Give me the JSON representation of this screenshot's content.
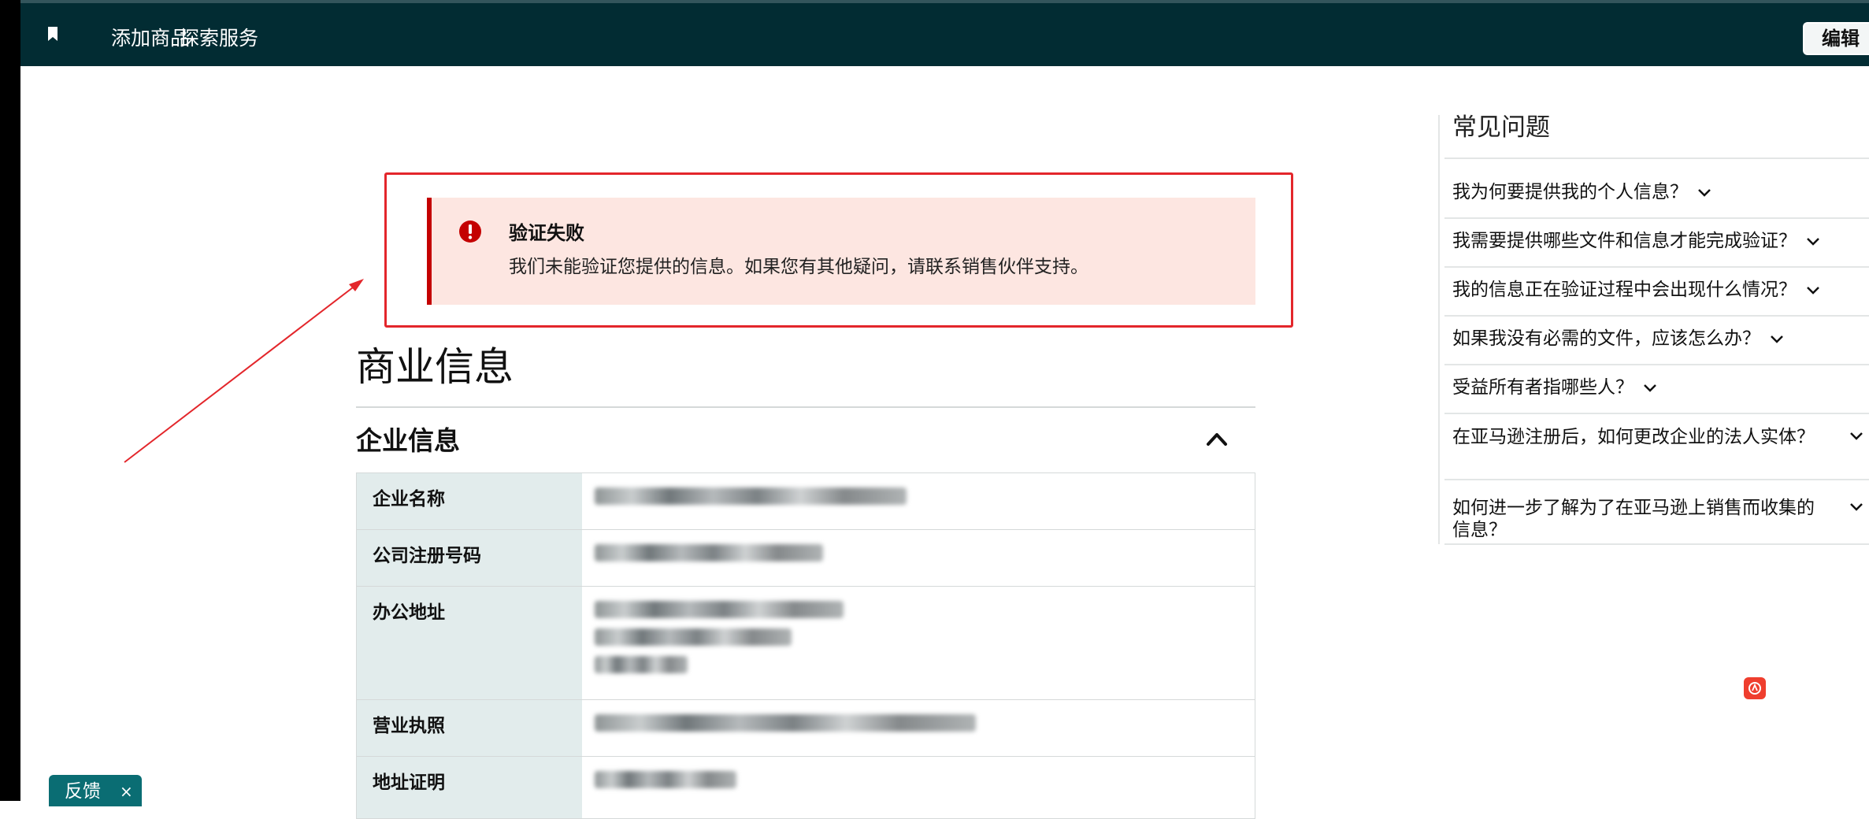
{
  "topbar": {
    "nav_links": [
      "添加商品",
      "探索服务"
    ],
    "edit_label": "编辑"
  },
  "alert": {
    "title": "验证失败",
    "message": "我们未能验证您提供的信息。如果您有其他疑问，请联系销售伙伴支持。",
    "icon": "exclamation-circle-icon",
    "color": "#c40000"
  },
  "main": {
    "page_title": "商业信息",
    "section_title": "企业信息",
    "rows": [
      {
        "label": "企业名称",
        "value_lines": 1
      },
      {
        "label": "公司注册号码",
        "value_lines": 1
      },
      {
        "label": "办公地址",
        "value_lines": 3
      },
      {
        "label": "营业执照",
        "value_lines": 1
      },
      {
        "label": "地址证明",
        "value_lines": 1
      }
    ]
  },
  "faq": {
    "title": "常见问题",
    "items": [
      "我为何要提供我的个人信息？",
      "我需要提供哪些文件和信息才能完成验证？",
      "我的信息正在验证过程中会出现什么情况？",
      "如果我没有必需的文件，应该怎么办？",
      "受益所有者指哪些人？",
      "在亚马逊注册后，如何更改企业的法人实体？",
      "如何进一步了解为了在亚马逊上销售而收集的信息？"
    ]
  },
  "feedback": {
    "label": "反馈",
    "close": "×"
  },
  "colors": {
    "topbar": "#022c33",
    "alert_bg": "#fde6e1",
    "highlight": "#e3262b",
    "label_bg": "#e2ecec",
    "feedback": "#0a6d73"
  }
}
